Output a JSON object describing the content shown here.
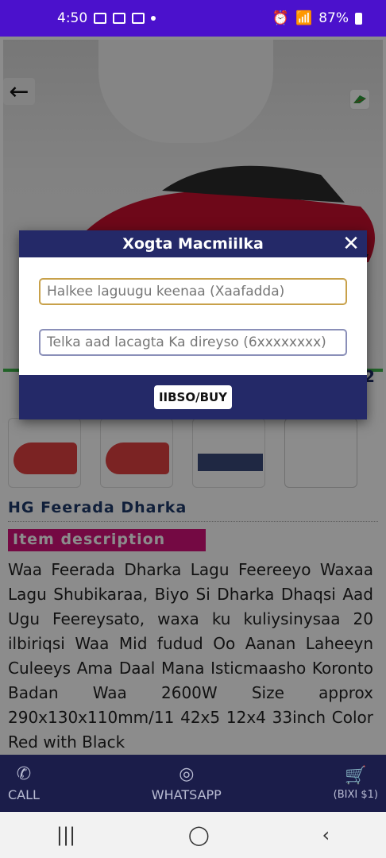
{
  "status_bar": {
    "time": "4:50",
    "battery": "87%"
  },
  "hero": {
    "page_indicator": "2"
  },
  "product": {
    "title": "HG Feerada Dharka"
  },
  "description": {
    "label": "Item description",
    "text": "Waa Feerada Dharka Lagu Feereeyo Waxaa Lagu Shubikaraa, Biyo Si Dharka Dhaqsi Aad Ugu Feereysato, waxa ku kuliysinysaa 20 ilbiriqsi Waa Mid fudud Oo Aanan Laheeyn Culeeys Ama Daal Mana Isticmaasho Koronto Badan Waa 2600W Size approx 290x130x110mm/11 42x5 12x4 33inch Color Red with Black"
  },
  "dialog": {
    "title": "Xogta Macmiilka",
    "close": "✕",
    "address_placeholder": "Halkee laguugu keenaa (Xaafadda)",
    "phone_placeholder": "Telka aad lacagta Ka direyso (6xxxxxxxx)",
    "buy_label": "IIBSO/BUY"
  },
  "bottom_nav": {
    "call": "CALL",
    "whatsapp": "WHATSAPP",
    "cart": "(BIXI $1)"
  },
  "colors": {
    "status_bar": "#4b11cc",
    "dialog_header": "#242968",
    "desc_label": "#d3127a",
    "bottom_nav": "#1b1d4a"
  },
  "icons": [
    "back-arrow-icon",
    "phone-icon",
    "whatsapp-icon",
    "cart-icon",
    "close-icon"
  ]
}
